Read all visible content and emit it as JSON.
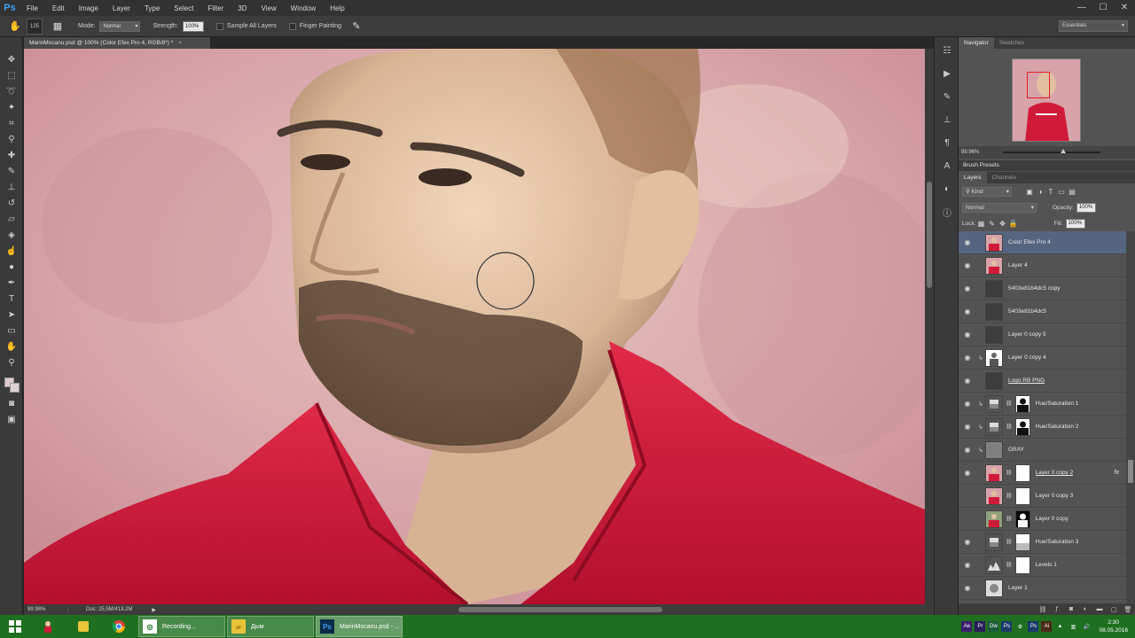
{
  "app": {
    "logo": "Ps"
  },
  "menu": [
    "File",
    "Edit",
    "Image",
    "Layer",
    "Type",
    "Select",
    "Filter",
    "3D",
    "View",
    "Window",
    "Help"
  ],
  "window_controls": {
    "minimize": "—",
    "maximize": "☐",
    "close": "✕"
  },
  "options": {
    "brush_size": "125",
    "mode_label": "Mode:",
    "mode_value": "Normal",
    "strength_label": "Strength:",
    "strength_value": "100%",
    "sample_all_layers": "Sample All Layers",
    "finger_painting": "Finger Painting",
    "workspace": "Essentials"
  },
  "document": {
    "tab_title": "MarinMocanu.psd @ 100% (Color Efex Pro 4, RGB/8*) *",
    "close": "×"
  },
  "status": {
    "zoom": "99.96%",
    "doc": "Doc: 25,5M/413,2M",
    "arrow": "▶"
  },
  "panels": {
    "navigator_tabs": [
      "Navigator",
      "Swatches"
    ],
    "navigator_zoom": "99.96%",
    "brush_presets": "Brush Presets",
    "layers_tabs": [
      "Layers",
      "Channels"
    ],
    "kind": "Kind",
    "blend_mode": "Normal",
    "opacity_label": "Opacity:",
    "opacity_value": "100%",
    "lock_label": "Lock:",
    "fill_label": "Fill:",
    "fill_value": "100%"
  },
  "layers": [
    {
      "name": "Color Efex Pro 4",
      "visible": true,
      "selected": true,
      "thumb": "portrait",
      "mask": false,
      "clip": false,
      "underline": false,
      "fx": false
    },
    {
      "name": "Layer 4",
      "visible": true,
      "selected": false,
      "thumb": "portrait",
      "mask": false,
      "clip": false,
      "underline": false,
      "fx": false
    },
    {
      "name": "5403e81b4dc5 copy",
      "visible": true,
      "selected": false,
      "thumb": "dark",
      "mask": false,
      "clip": false,
      "underline": false,
      "fx": false
    },
    {
      "name": "5403e81b4dc5",
      "visible": true,
      "selected": false,
      "thumb": "dark",
      "mask": false,
      "clip": false,
      "underline": false,
      "fx": false
    },
    {
      "name": "Layer 0 copy 5",
      "visible": true,
      "selected": false,
      "thumb": "dark",
      "mask": false,
      "clip": false,
      "underline": false,
      "fx": false
    },
    {
      "name": "Layer 0 copy 4",
      "visible": true,
      "selected": false,
      "thumb": "figure",
      "mask": false,
      "clip": true,
      "underline": false,
      "fx": false
    },
    {
      "name": "Logo RB PNG",
      "visible": true,
      "selected": false,
      "thumb": "dark",
      "mask": false,
      "clip": false,
      "underline": true,
      "fx": false
    },
    {
      "name": "Hue/Saturation 1",
      "visible": true,
      "selected": false,
      "thumb": "adjust",
      "mask": "silhouette",
      "clip": true,
      "underline": false,
      "fx": false
    },
    {
      "name": "Hue/Saturation 2",
      "visible": true,
      "selected": false,
      "thumb": "adjust",
      "mask": "silhouette",
      "clip": true,
      "underline": false,
      "fx": false
    },
    {
      "name": "GRAY",
      "visible": true,
      "selected": false,
      "thumb": "gray",
      "mask": false,
      "clip": true,
      "underline": false,
      "fx": false
    },
    {
      "name": "Layer 0 copy 2",
      "visible": true,
      "selected": false,
      "thumb": "portrait",
      "mask": "white",
      "clip": false,
      "underline": true,
      "fx": true
    },
    {
      "name": "Layer 0 copy 3",
      "visible": false,
      "selected": false,
      "thumb": "portrait",
      "mask": "white",
      "clip": false,
      "underline": false,
      "fx": false
    },
    {
      "name": "Layer 0 copy",
      "visible": false,
      "selected": false,
      "thumb": "portrait2",
      "mask": "silhouette-white",
      "clip": false,
      "underline": false,
      "fx": false
    },
    {
      "name": "Hue/Saturation 3",
      "visible": true,
      "selected": false,
      "thumb": "adjust",
      "mask": "white-soft",
      "clip": false,
      "underline": false,
      "fx": false
    },
    {
      "name": "Levels 1",
      "visible": true,
      "selected": false,
      "thumb": "levels",
      "mask": "white",
      "clip": false,
      "underline": false,
      "fx": false
    },
    {
      "name": "Layer 1",
      "visible": true,
      "selected": false,
      "thumb": "pattern",
      "mask": false,
      "clip": false,
      "underline": false,
      "fx": false
    }
  ],
  "fx_label": "fx",
  "taskbar": {
    "apps": [
      {
        "name": "Recording...",
        "icon": "recording-app-icon",
        "active": false
      },
      {
        "name": "Дым",
        "icon": "folder-icon",
        "active": false
      },
      {
        "name": "MarinMocanu.psd - ...",
        "icon": "photoshop-icon",
        "active": true
      }
    ],
    "time": "2:30",
    "date": "08.05.2016"
  },
  "colors": {
    "accent": "#3fa0ef",
    "selected_layer": "#556580",
    "taskbar": "#1f6f20",
    "shirt": "#d01a3a"
  }
}
